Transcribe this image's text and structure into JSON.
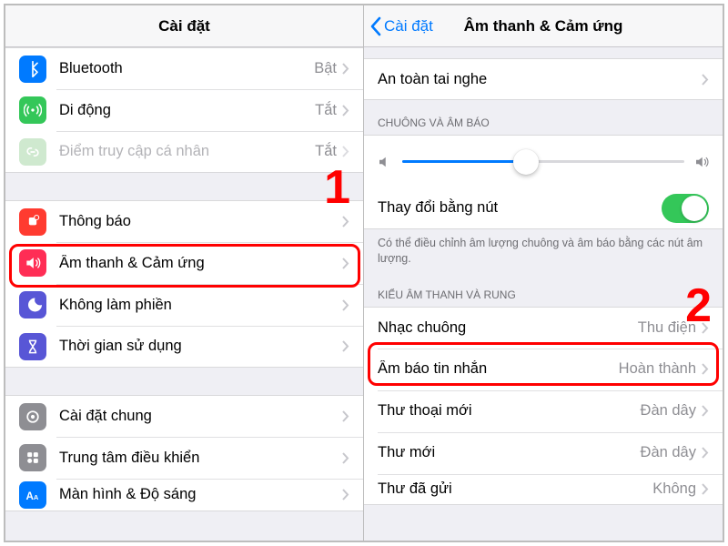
{
  "left": {
    "title": "Cài đặt",
    "group1": [
      {
        "key": "bluetooth",
        "label": "Bluetooth",
        "value": "Bật",
        "bg": "#007aff",
        "icon": "bt"
      },
      {
        "key": "cellular",
        "label": "Di động",
        "value": "Tắt",
        "bg": "#34c759",
        "icon": "antenna"
      },
      {
        "key": "hotspot",
        "label": "Điểm truy cập cá nhân",
        "value": "Tắt",
        "bg": "#d4efd4",
        "icon": "link",
        "disabled": true
      }
    ],
    "group2": [
      {
        "key": "notifications",
        "label": "Thông báo",
        "bg": "#ff3b30",
        "icon": "bell"
      },
      {
        "key": "sounds",
        "label": "Âm thanh & Cảm ứng",
        "bg": "#ff2d55",
        "icon": "speaker",
        "highlighted": true
      },
      {
        "key": "dnd",
        "label": "Không làm phiền",
        "bg": "#5856d6",
        "icon": "moon"
      },
      {
        "key": "screentime",
        "label": "Thời gian sử dụng",
        "bg": "#5856d6",
        "icon": "hourglass"
      }
    ],
    "group3": [
      {
        "key": "general",
        "label": "Cài đặt chung",
        "bg": "#8e8e93",
        "icon": "gear"
      },
      {
        "key": "controlcenter",
        "label": "Trung tâm điều khiển",
        "bg": "#8e8e93",
        "icon": "sliders"
      },
      {
        "key": "display",
        "label": "Màn hình & Độ sáng",
        "bg": "#007aff",
        "icon": "aa"
      }
    ]
  },
  "right": {
    "back": "Cài đặt",
    "title": "Âm thanh & Cảm ứng",
    "headphone_safety": "An toàn tai nghe",
    "section_ringer": "CHUÔNG VÀ ÂM BÁO",
    "slider_value": 0.44,
    "change_with_buttons": "Thay đổi bằng nút",
    "change_with_buttons_on": true,
    "buttons_footer": "Có thể điều chỉnh âm lượng chuông và âm báo bằng các nút âm lượng.",
    "section_sounds": "KIỂU ÂM THANH VÀ RUNG",
    "rows": [
      {
        "key": "ringtone",
        "label": "Nhạc chuông",
        "value": "Thu điện",
        "highlighted": true
      },
      {
        "key": "texttone",
        "label": "Âm báo tin nhắn",
        "value": "Hoàn thành"
      },
      {
        "key": "voicemail",
        "label": "Thư thoại mới",
        "value": "Đàn dây"
      },
      {
        "key": "newmail",
        "label": "Thư mới",
        "value": "Đàn dây"
      },
      {
        "key": "sentmail",
        "label": "Thư đã gửi",
        "value": "Không"
      }
    ]
  },
  "annotations": {
    "step1": "1",
    "step2": "2"
  }
}
